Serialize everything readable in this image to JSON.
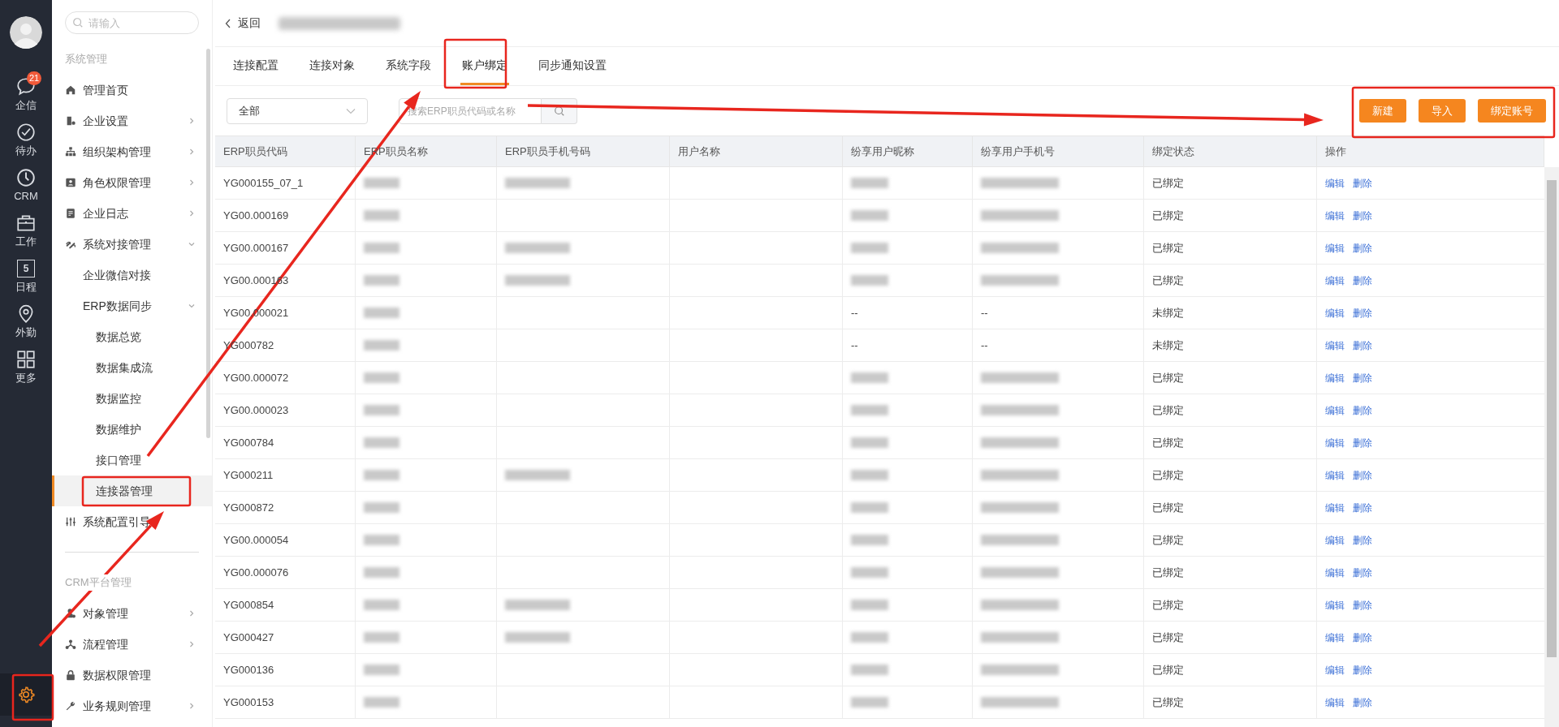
{
  "rail": {
    "items": [
      {
        "label": "企信",
        "badge": "21"
      },
      {
        "label": "待办"
      },
      {
        "label": "CRM"
      },
      {
        "label": "工作"
      },
      {
        "label": "日程",
        "icon_text": "5"
      },
      {
        "label": "外勤"
      },
      {
        "label": "更多"
      }
    ],
    "settings": {
      "selected": true
    }
  },
  "sidebar": {
    "search": {
      "placeholder": "请输入"
    },
    "sections": [
      {
        "title": "系统管理",
        "items": [
          {
            "label": "管理首页",
            "selected": false
          },
          {
            "label": "企业设置",
            "expanded": false,
            "selected": false
          },
          {
            "label": "组织架构管理",
            "expanded": false,
            "selected": false
          },
          {
            "label": "角色权限管理",
            "expanded": false,
            "selected": false
          },
          {
            "label": "企业日志",
            "expanded": false,
            "selected": false
          },
          {
            "label": "系统对接管理",
            "expanded": true,
            "selected": false,
            "children": [
              {
                "label": "企业微信对接",
                "selected": false
              },
              {
                "label": "ERP数据同步",
                "expanded": true,
                "selected": false,
                "children": [
                  {
                    "label": "数据总览",
                    "selected": false
                  },
                  {
                    "label": "数据集成流",
                    "selected": false
                  },
                  {
                    "label": "数据监控",
                    "selected": false
                  },
                  {
                    "label": "数据维护",
                    "selected": false
                  },
                  {
                    "label": "接口管理",
                    "selected": false
                  },
                  {
                    "label": "连接器管理",
                    "selected": true
                  }
                ]
              }
            ]
          },
          {
            "label": "系统配置引导",
            "selected": false
          }
        ]
      },
      {
        "title": "CRM平台管理",
        "items": [
          {
            "label": "对象管理",
            "expanded": false,
            "selected": false
          },
          {
            "label": "流程管理",
            "expanded": false,
            "selected": false
          },
          {
            "label": "数据权限管理",
            "selected": false
          },
          {
            "label": "业务规则管理",
            "expanded": false,
            "selected": false
          }
        ]
      }
    ]
  },
  "header": {
    "back": "返回",
    "title_redacted": true
  },
  "tabs": [
    {
      "label": "连接配置",
      "selected": false
    },
    {
      "label": "连接对象",
      "selected": false
    },
    {
      "label": "系统字段",
      "selected": false
    },
    {
      "label": "账户绑定",
      "selected": true
    },
    {
      "label": "同步通知设置",
      "selected": false
    }
  ],
  "filter": {
    "select": "全部",
    "search_placeholder": "搜索ERP职员代码或名称"
  },
  "buttons": [
    "新建",
    "导入",
    "绑定账号"
  ],
  "table": {
    "columns": [
      "ERP职员代码",
      "ERP职员名称",
      "ERP职员手机号码",
      "用户名称",
      "纷享用户昵称",
      "纷享用户手机号",
      "绑定状态",
      "操作"
    ],
    "rows": [
      {
        "cells": [
          {
            "kind": "text",
            "text": "YG000155_07_1"
          },
          {
            "kind": "blurred"
          },
          {
            "kind": "blurred"
          },
          {
            "kind": "empty"
          },
          {
            "kind": "blurred"
          },
          {
            "kind": "blurred"
          },
          {
            "kind": "text",
            "text": "已绑定"
          }
        ],
        "actions": [
          "编辑",
          "删除"
        ]
      },
      {
        "cells": [
          {
            "kind": "text",
            "text": "YG00.000169"
          },
          {
            "kind": "blurred"
          },
          {
            "kind": "empty"
          },
          {
            "kind": "empty"
          },
          {
            "kind": "blurred"
          },
          {
            "kind": "blurred"
          },
          {
            "kind": "text",
            "text": "已绑定"
          }
        ],
        "actions": [
          "编辑",
          "删除"
        ]
      },
      {
        "cells": [
          {
            "kind": "text",
            "text": "YG00.000167"
          },
          {
            "kind": "blurred"
          },
          {
            "kind": "blurred"
          },
          {
            "kind": "empty"
          },
          {
            "kind": "blurred"
          },
          {
            "kind": "blurred"
          },
          {
            "kind": "text",
            "text": "已绑定"
          }
        ],
        "actions": [
          "编辑",
          "删除"
        ]
      },
      {
        "cells": [
          {
            "kind": "text",
            "text": "YG00.000163"
          },
          {
            "kind": "blurred"
          },
          {
            "kind": "blurred"
          },
          {
            "kind": "empty"
          },
          {
            "kind": "blurred"
          },
          {
            "kind": "blurred"
          },
          {
            "kind": "text",
            "text": "已绑定"
          }
        ],
        "actions": [
          "编辑",
          "删除"
        ]
      },
      {
        "cells": [
          {
            "kind": "text",
            "text": "YG00.000021"
          },
          {
            "kind": "blurred"
          },
          {
            "kind": "empty"
          },
          {
            "kind": "empty"
          },
          {
            "kind": "text",
            "text": "--"
          },
          {
            "kind": "text",
            "text": "--"
          },
          {
            "kind": "text",
            "text": "未绑定"
          }
        ],
        "actions": [
          "编辑",
          "删除"
        ]
      },
      {
        "cells": [
          {
            "kind": "text",
            "text": "YG000782"
          },
          {
            "kind": "blurred"
          },
          {
            "kind": "empty"
          },
          {
            "kind": "empty"
          },
          {
            "kind": "text",
            "text": "--"
          },
          {
            "kind": "text",
            "text": "--"
          },
          {
            "kind": "text",
            "text": "未绑定"
          }
        ],
        "actions": [
          "编辑",
          "删除"
        ]
      },
      {
        "cells": [
          {
            "kind": "text",
            "text": "YG00.000072"
          },
          {
            "kind": "blurred"
          },
          {
            "kind": "empty"
          },
          {
            "kind": "empty"
          },
          {
            "kind": "blurred"
          },
          {
            "kind": "blurred"
          },
          {
            "kind": "text",
            "text": "已绑定"
          }
        ],
        "actions": [
          "编辑",
          "删除"
        ]
      },
      {
        "cells": [
          {
            "kind": "text",
            "text": "YG00.000023"
          },
          {
            "kind": "blurred"
          },
          {
            "kind": "empty"
          },
          {
            "kind": "empty"
          },
          {
            "kind": "blurred"
          },
          {
            "kind": "blurred"
          },
          {
            "kind": "text",
            "text": "已绑定"
          }
        ],
        "actions": [
          "编辑",
          "删除"
        ]
      },
      {
        "cells": [
          {
            "kind": "text",
            "text": "YG000784"
          },
          {
            "kind": "blurred"
          },
          {
            "kind": "empty"
          },
          {
            "kind": "empty"
          },
          {
            "kind": "blurred"
          },
          {
            "kind": "blurred"
          },
          {
            "kind": "text",
            "text": "已绑定"
          }
        ],
        "actions": [
          "编辑",
          "删除"
        ]
      },
      {
        "cells": [
          {
            "kind": "text",
            "text": "YG000211"
          },
          {
            "kind": "blurred"
          },
          {
            "kind": "blurred"
          },
          {
            "kind": "empty"
          },
          {
            "kind": "blurred"
          },
          {
            "kind": "blurred"
          },
          {
            "kind": "text",
            "text": "已绑定"
          }
        ],
        "actions": [
          "编辑",
          "删除"
        ]
      },
      {
        "cells": [
          {
            "kind": "text",
            "text": "YG000872"
          },
          {
            "kind": "blurred"
          },
          {
            "kind": "empty"
          },
          {
            "kind": "empty"
          },
          {
            "kind": "blurred"
          },
          {
            "kind": "blurred"
          },
          {
            "kind": "text",
            "text": "已绑定"
          }
        ],
        "actions": [
          "编辑",
          "删除"
        ]
      },
      {
        "cells": [
          {
            "kind": "text",
            "text": "YG00.000054"
          },
          {
            "kind": "blurred"
          },
          {
            "kind": "empty"
          },
          {
            "kind": "empty"
          },
          {
            "kind": "blurred"
          },
          {
            "kind": "blurred"
          },
          {
            "kind": "text",
            "text": "已绑定"
          }
        ],
        "actions": [
          "编辑",
          "删除"
        ]
      },
      {
        "cells": [
          {
            "kind": "text",
            "text": "YG00.000076"
          },
          {
            "kind": "blurred"
          },
          {
            "kind": "empty"
          },
          {
            "kind": "empty"
          },
          {
            "kind": "blurred"
          },
          {
            "kind": "blurred"
          },
          {
            "kind": "text",
            "text": "已绑定"
          }
        ],
        "actions": [
          "编辑",
          "删除"
        ]
      },
      {
        "cells": [
          {
            "kind": "text",
            "text": "YG000854"
          },
          {
            "kind": "blurred"
          },
          {
            "kind": "blurred"
          },
          {
            "kind": "empty"
          },
          {
            "kind": "blurred"
          },
          {
            "kind": "blurred"
          },
          {
            "kind": "text",
            "text": "已绑定"
          }
        ],
        "actions": [
          "编辑",
          "删除"
        ]
      },
      {
        "cells": [
          {
            "kind": "text",
            "text": "YG000427"
          },
          {
            "kind": "blurred"
          },
          {
            "kind": "blurred"
          },
          {
            "kind": "empty"
          },
          {
            "kind": "blurred"
          },
          {
            "kind": "blurred"
          },
          {
            "kind": "text",
            "text": "已绑定"
          }
        ],
        "actions": [
          "编辑",
          "删除"
        ]
      },
      {
        "cells": [
          {
            "kind": "text",
            "text": "YG000136"
          },
          {
            "kind": "blurred"
          },
          {
            "kind": "empty"
          },
          {
            "kind": "empty"
          },
          {
            "kind": "blurred"
          },
          {
            "kind": "blurred"
          },
          {
            "kind": "text",
            "text": "已绑定"
          }
        ],
        "actions": [
          "编辑",
          "删除"
        ]
      },
      {
        "cells": [
          {
            "kind": "text",
            "text": "YG000153"
          },
          {
            "kind": "blurred"
          },
          {
            "kind": "empty"
          },
          {
            "kind": "empty"
          },
          {
            "kind": "blurred"
          },
          {
            "kind": "blurred"
          },
          {
            "kind": "text",
            "text": "已绑定"
          }
        ],
        "actions": [
          "编辑",
          "删除"
        ]
      }
    ]
  }
}
